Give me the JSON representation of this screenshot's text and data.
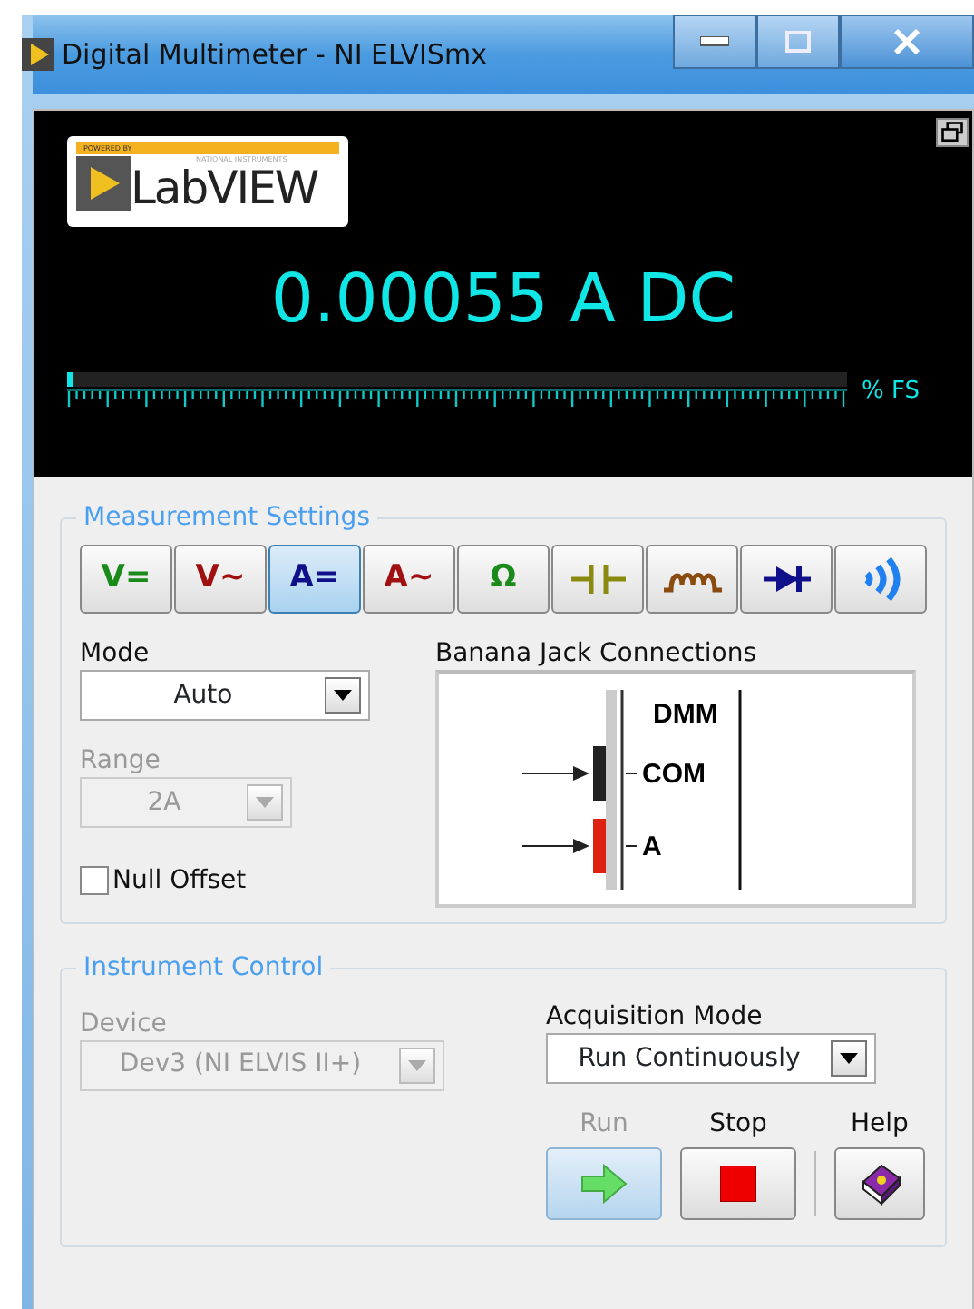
{
  "window": {
    "title": "Digital Multimeter - NI ELVISmx"
  },
  "display": {
    "logo_small": "POWERED BY",
    "logo_tagline": "NATIONAL INSTRUMENTS",
    "logo_text": "LabVIEW",
    "reading": "0.00055 A DC",
    "meter": {
      "level": 0.0,
      "unit": "% FS"
    }
  },
  "measurement_settings": {
    "title": "Measurement Settings",
    "functions": [
      {
        "kind": "text",
        "label": "V=",
        "color": "#1a8a1a",
        "selected": false
      },
      {
        "kind": "text",
        "label": "V~",
        "color": "#a01010",
        "selected": false
      },
      {
        "kind": "text",
        "label": "A=",
        "color": "#10108a",
        "selected": true
      },
      {
        "kind": "text",
        "label": "A~",
        "color": "#a01010",
        "selected": false
      },
      {
        "kind": "text",
        "label": "Ω",
        "color": "#1a8a1a",
        "selected": false
      },
      {
        "kind": "capacitor",
        "color": "#8a8a10",
        "selected": false
      },
      {
        "kind": "inductor",
        "color": "#8a4a10",
        "selected": false
      },
      {
        "kind": "diode",
        "color": "#10108a",
        "selected": false
      },
      {
        "kind": "continuity",
        "color": "#2080f0",
        "selected": false
      }
    ],
    "mode": {
      "label": "Mode",
      "value": "Auto",
      "disabled": false
    },
    "range": {
      "label": "Range",
      "value": "2A",
      "disabled": true
    },
    "null_offset": {
      "label": "Null Offset",
      "checked": false
    },
    "banana_jack": {
      "label": "Banana Jack Connections",
      "header": "DMM",
      "jacks": [
        {
          "label": "COM",
          "color": "#222222"
        },
        {
          "label": "A",
          "color": "#dd2211"
        }
      ]
    }
  },
  "instrument_control": {
    "title": "Instrument Control",
    "device": {
      "label": "Device",
      "value": "Dev3 (NI ELVIS II+)",
      "disabled": true
    },
    "acquisition_mode": {
      "label": "Acquisition Mode",
      "value": "Run Continuously",
      "disabled": false
    },
    "buttons": [
      {
        "kind": "run",
        "label": "Run",
        "disabled": true
      },
      {
        "kind": "stop",
        "label": "Stop",
        "disabled": false
      },
      {
        "kind": "help",
        "label": "Help",
        "disabled": false
      }
    ]
  }
}
